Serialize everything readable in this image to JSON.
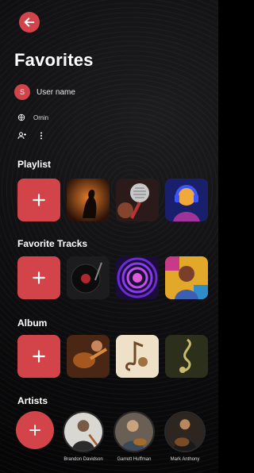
{
  "header": {
    "title": "Favorites"
  },
  "user": {
    "initial": "S",
    "name": "User name"
  },
  "meta": {
    "location": "Omin"
  },
  "sections": {
    "playlist": {
      "title": "Playlist"
    },
    "favorite_tracks": {
      "title": "Favorite Tracks"
    },
    "album": {
      "title": "Album"
    },
    "artists": {
      "title": "Artists"
    }
  },
  "artists": [
    {
      "name": "Brandon Davidson"
    },
    {
      "name": "Garrett Huffman"
    },
    {
      "name": "Mark Anthony"
    }
  ],
  "colors": {
    "accent": "#d3444a",
    "background": "#0e0e10"
  },
  "icons": {
    "back": "arrow-left-icon",
    "globe": "globe-icon",
    "add_user": "add-user-icon",
    "more": "more-vertical-icon",
    "plus": "plus-icon"
  }
}
